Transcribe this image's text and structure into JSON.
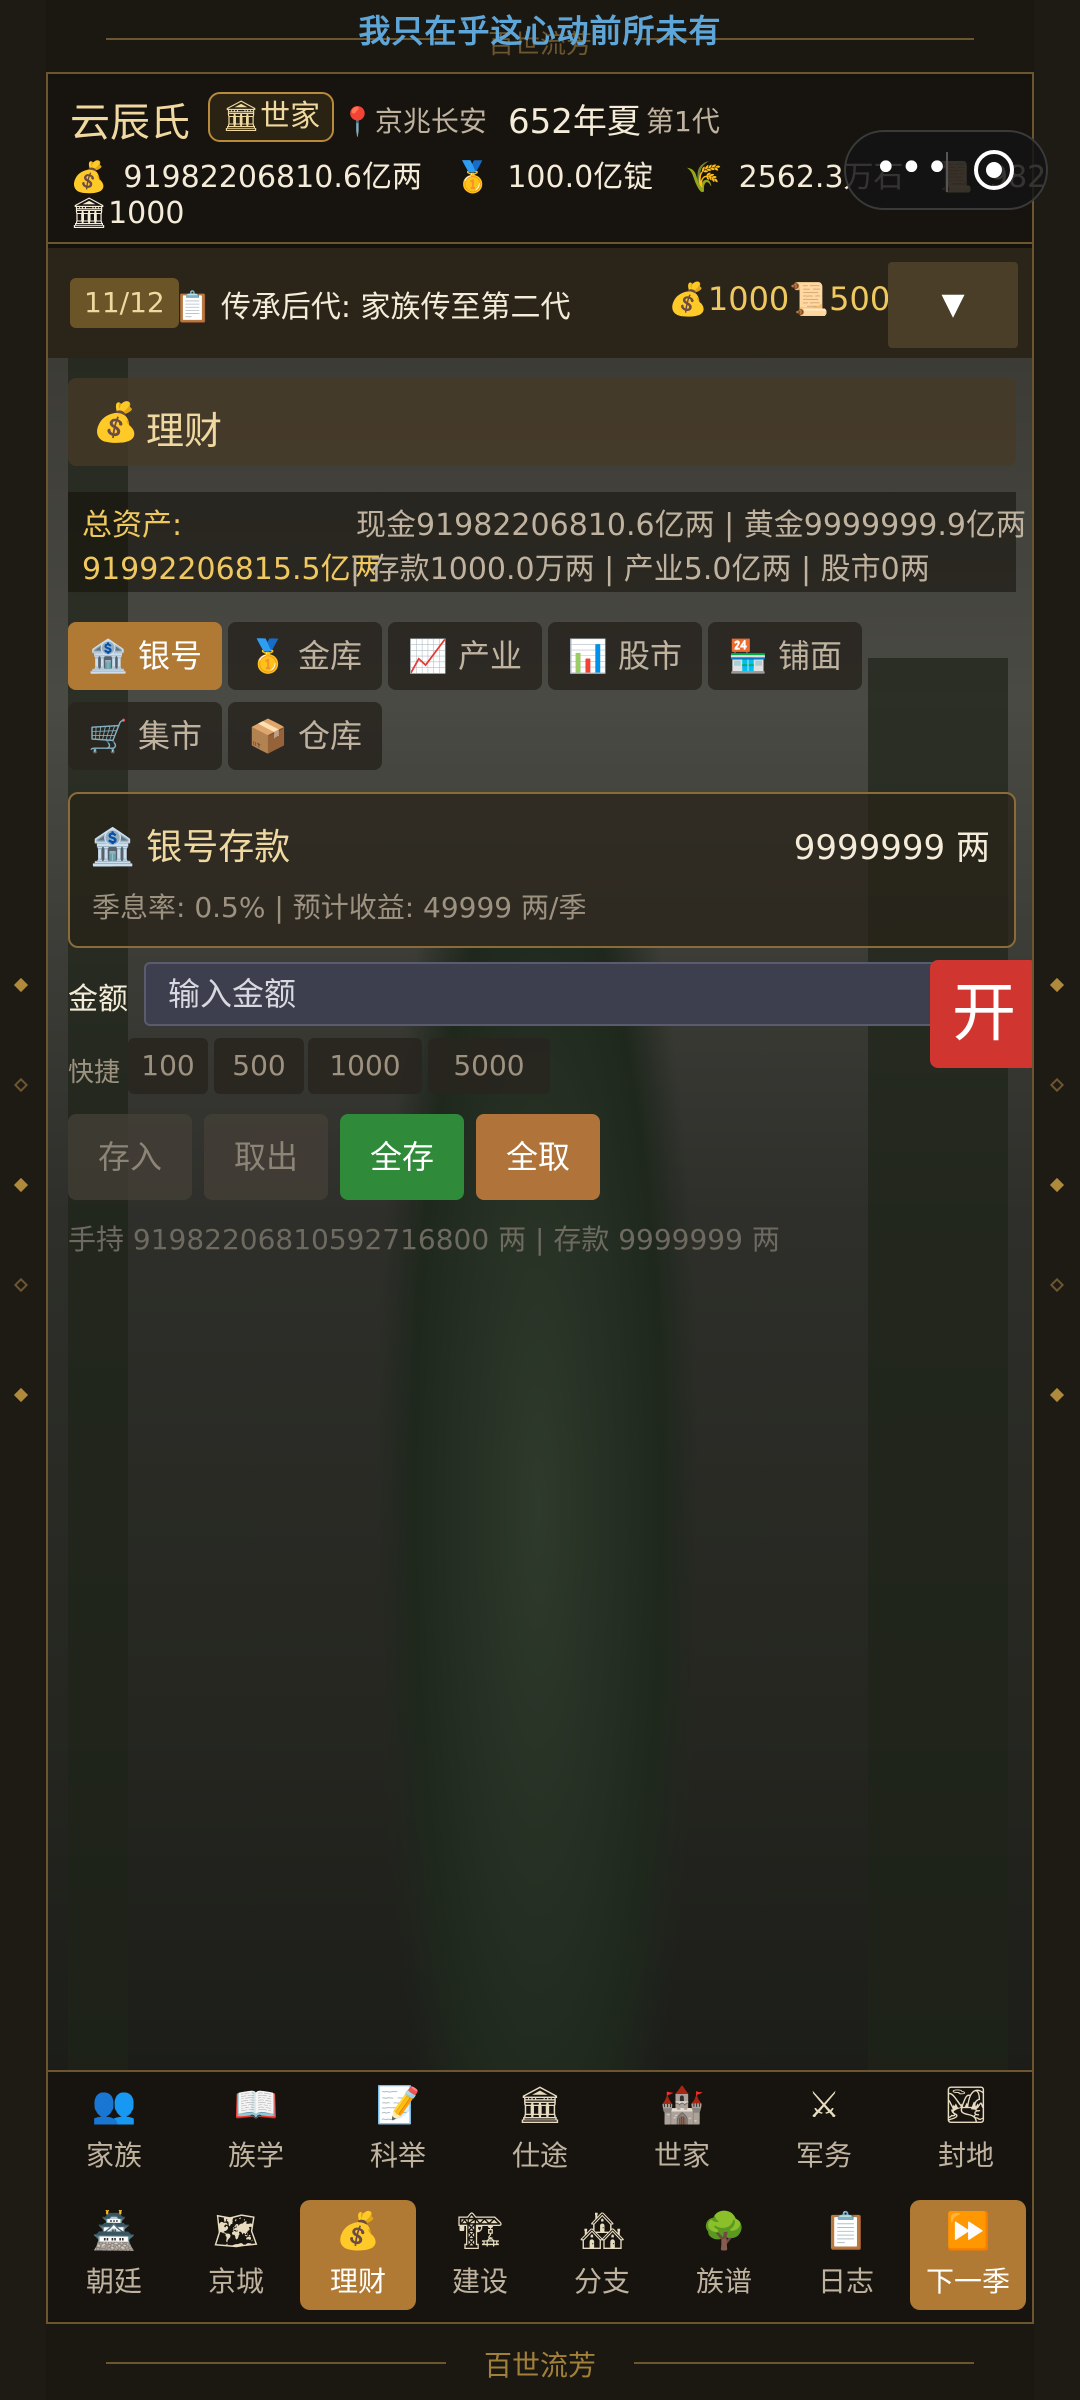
{
  "banner": {
    "title": "我只在乎这心动前所未有",
    "ghost": "百世流芳"
  },
  "header": {
    "clan_name": "云辰氏",
    "rank": "世家",
    "location": "京兆长安",
    "year": "652年夏",
    "generation": "第1代",
    "resources": {
      "silver": "91982206810.6亿两",
      "gold": "100.0亿锭",
      "grain": "2562.3万石",
      "scroll": "982",
      "prestige": "1000"
    }
  },
  "quest": {
    "progress": "11/12",
    "text": "传承后代: 家族传至第二代",
    "reward_silver": "1000",
    "reward_scroll": "500",
    "dropdown": "▼"
  },
  "panel": {
    "title": "理财",
    "assets_label": "总资产:",
    "assets_total": "91992206815.5亿两",
    "assets_detail_line1": "现金91982206810.6亿两 | 黄金9999999.9亿两",
    "assets_detail_line2": "| 存款1000.0万两 | 产业5.0亿两 | 股市0两",
    "tabs": [
      "银号",
      "金库",
      "产业",
      "股市",
      "铺面",
      "集市",
      "仓库"
    ],
    "bank": {
      "title": "银号存款",
      "amount": "9999999 两",
      "rate_text": "季息率: 0.5%  |  预计收益: 49999 两/季"
    },
    "amount_label": "金额",
    "amount_placeholder": "输入金额",
    "open_label": "开",
    "quick_label": "快捷",
    "quick": [
      "100",
      "500",
      "1000",
      "5000"
    ],
    "actions": {
      "deposit": "存入",
      "withdraw": "取出",
      "deposit_all": "全存",
      "withdraw_all": "全取"
    },
    "holdings": "手持 91982206810592716800 两  |  存款 9999999 两"
  },
  "nav": {
    "row1": [
      "家族",
      "族学",
      "科举",
      "仕途",
      "世家",
      "军务",
      "封地"
    ],
    "row2": [
      "朝廷",
      "京城",
      "理财",
      "建设",
      "分支",
      "族谱",
      "日志",
      "下一季"
    ]
  },
  "footer": {
    "title": "百世流芳"
  },
  "colors": {
    "accent": "#b07a34",
    "gold_text": "#f0c860",
    "open_red": "#d03530",
    "deposit_all_green": "#2f8a3a"
  }
}
